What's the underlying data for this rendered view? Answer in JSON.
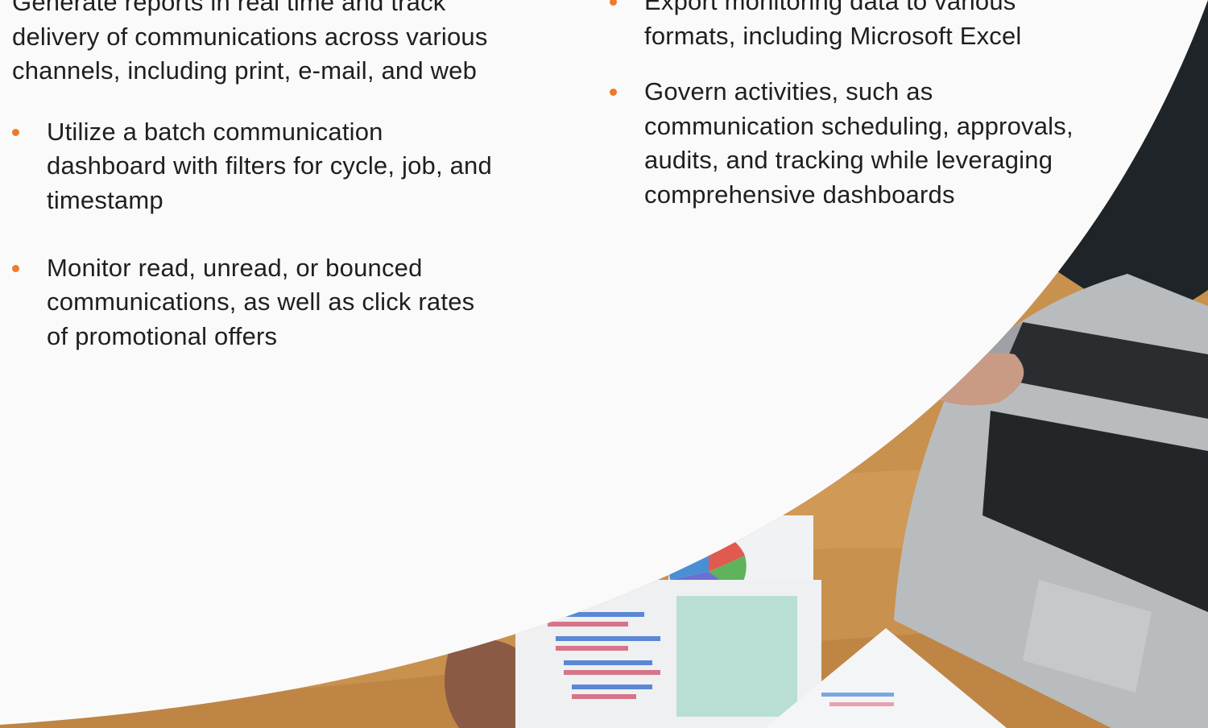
{
  "colors": {
    "background": "#fafafa",
    "text": "#1f1f1f",
    "bullet_accent": "#ee7a2a",
    "desk_wood": "#c8914e"
  },
  "left_column": {
    "intro": "Generate reports in real time and track delivery of communications across various channels, including print, e-mail, and web",
    "bullets": [
      "Utilize a batch communication dashboard with filters for cycle, job, and timestamp",
      "Monitor read, unread, or bounced communications, as well as click rates of promotional offers"
    ]
  },
  "right_column": {
    "bullets": [
      "Export monitoring data to various formats, including Microsoft Excel",
      "Govern activities, such as communication scheduling, approvals, audits, and tracking while leveraging comprehensive dashboards"
    ]
  },
  "photo": {
    "icons": [
      "laptop-icon",
      "pie-chart-icon",
      "bar-chart-icon",
      "hand-icon"
    ]
  }
}
